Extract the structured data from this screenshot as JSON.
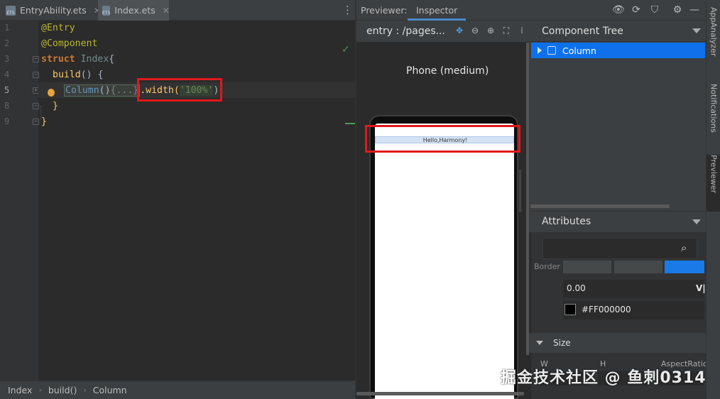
{
  "editor_tabs": [
    {
      "label": "EntryAbility.ets",
      "icon": "ets-file-icon"
    },
    {
      "label": "Index.ets",
      "icon": "ets-file-icon",
      "active": true
    }
  ],
  "file_icon_text": "ETS",
  "code": {
    "line_numbers": [
      "1",
      "2",
      "3",
      "4",
      "5",
      "8",
      "9"
    ],
    "current_line": "5",
    "line1": "@Entry",
    "line2": "@Component",
    "line3_kw": "struct",
    "line3_name": "Index",
    "line3_brace": "{",
    "line4_fn": "build",
    "line4_rest": "() {",
    "line5_comp": "Column",
    "line5_paren": "()",
    "line5_folded": "{...}",
    "line5_method": ".width(",
    "line5_arg": "'100%'",
    "line5_close": ")",
    "line8": "}",
    "line9": "}"
  },
  "breadcrumb": [
    "Index",
    "build()",
    "Column"
  ],
  "previewer": {
    "label": "Previewer:",
    "tab": "Inspector",
    "entry": "entry : /pages...",
    "device": "Phone (medium)",
    "hello_text": "Hello,Harmony!"
  },
  "inspector": {
    "tree_title": "Component Tree",
    "tree_item": "Column",
    "attr_title": "Attributes",
    "border_label": "Border",
    "number_value": "0.00",
    "number_unit": "V|",
    "color_value": "#FF000000",
    "size_label": "Size",
    "w_label": "W",
    "h_label": "H",
    "aspect_label": "AspectRatio"
  },
  "side_tabs": [
    "AppAnalyzer",
    "Notifications",
    "Previewer"
  ],
  "watermark": "掘金技术社区 @ 鱼刺0314",
  "colors": {
    "highlight": "#e0181b",
    "selection": "#0e71eb",
    "editor_bg": "#2b2b2b"
  }
}
